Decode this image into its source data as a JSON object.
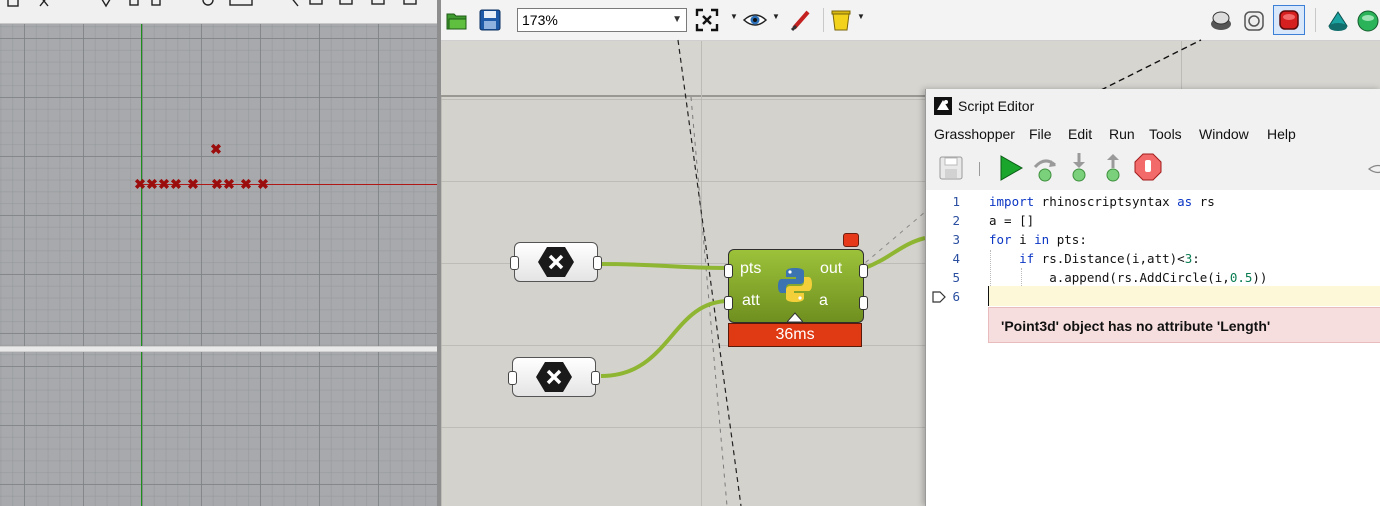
{
  "rhino": {
    "point_marker": "✖"
  },
  "grasshopper": {
    "toolbar": {
      "zoom_value": "173%",
      "icons": [
        "open-file-icon",
        "save-file-icon",
        "zoom-extents-icon",
        "preview-eye-icon",
        "sketch-brush-icon",
        "bin-icon",
        "preview-shaded-icon",
        "preview-wire-icon",
        "preview-selected-icon",
        "preview-custom-icon",
        "preview-mesh-icon"
      ]
    },
    "python_component": {
      "inputs": [
        "pts",
        "att"
      ],
      "outputs": [
        "out",
        "a"
      ],
      "runtime": "36ms",
      "status_color": "#e03a14"
    }
  },
  "script_editor": {
    "title": "Script Editor",
    "menu": [
      "Grasshopper",
      "File",
      "Edit",
      "Run",
      "Tools",
      "Window",
      "Help"
    ],
    "tools": [
      "save-icon",
      "run-icon",
      "step-over-icon",
      "step-into-icon",
      "step-out-icon",
      "stop-icon"
    ],
    "line_numbers": [
      "1",
      "2",
      "3",
      "4",
      "5",
      "6"
    ],
    "code_lines": [
      "import rhinoscriptsyntax as rs",
      "a = []",
      "for i in pts:",
      "    if rs.Distance(i,att)<3:",
      "        a.append(rs.AddCircle(i,0.5))",
      ""
    ],
    "error_message": "'Point3d' object has no attribute 'Length'"
  },
  "colors": {
    "accent_green": "#8fb632",
    "error_red": "#e03a14",
    "point_red": "#9b0d0d"
  }
}
